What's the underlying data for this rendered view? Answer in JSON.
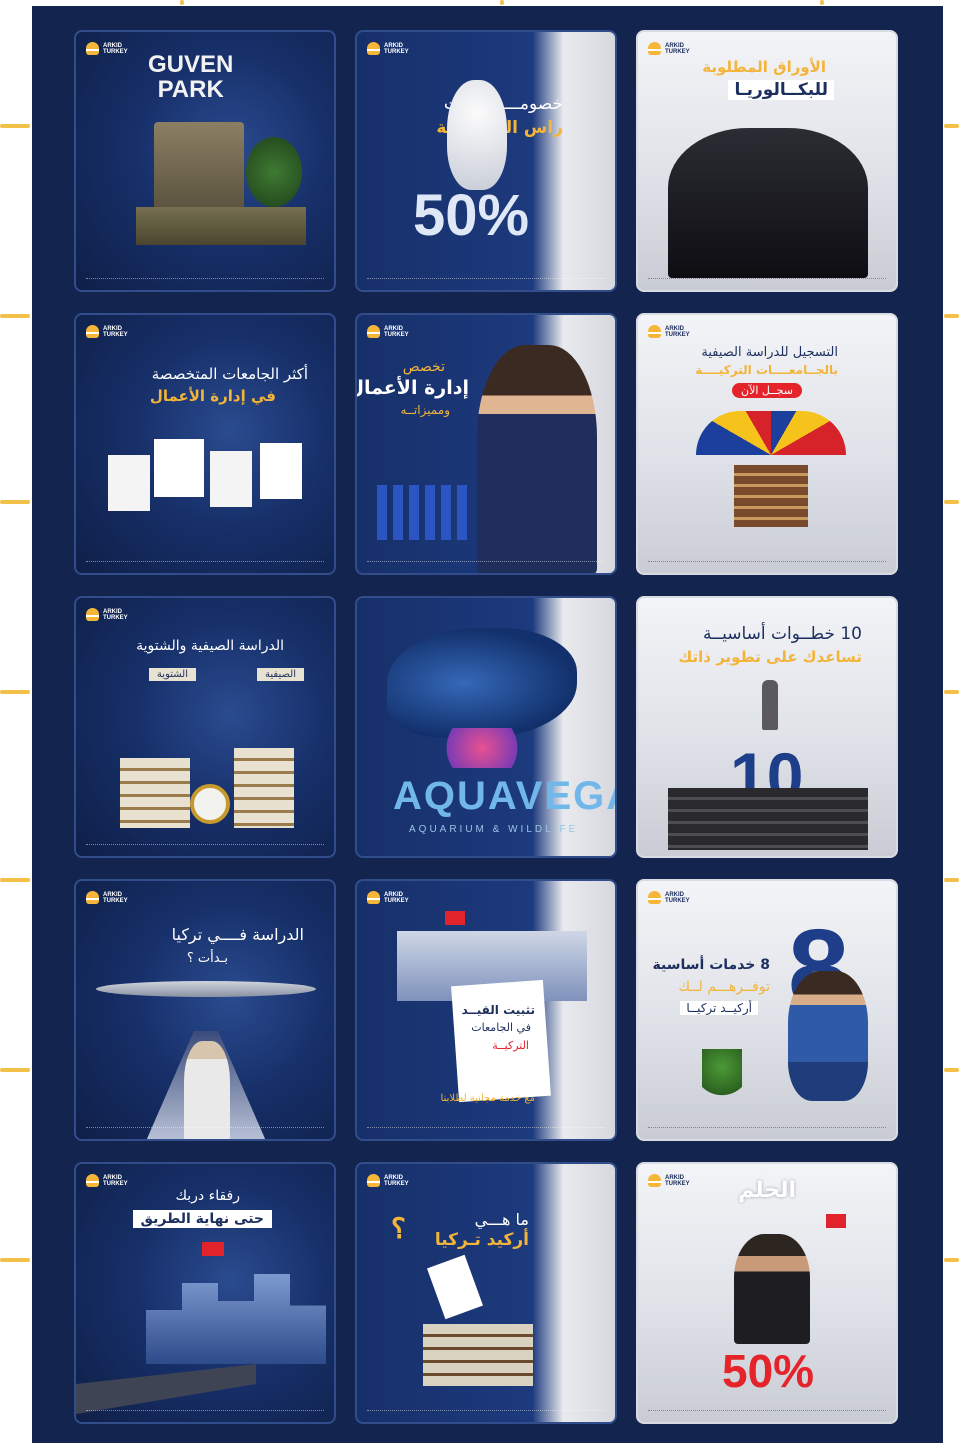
{
  "logo": {
    "text": "ARKID\nTURKEY",
    "name": "arkid-logo"
  },
  "tiles": {
    "t1": {
      "title": "GUVEN\nPARK"
    },
    "t2": {
      "line1": "خصومـــــــــــات",
      "line2": "راس الــــــسنة",
      "percent": "50%"
    },
    "t3": {
      "line1": "الأوراق المطلوبة",
      "line2": "للبكــالوريـا"
    },
    "t4": {
      "line1": "أكثر الجامعات المتخصصة",
      "line2": "في إدارة الأعمال"
    },
    "t5": {
      "line1": "تخصص",
      "line2": "إدارة الأعمال",
      "line3": "ومميزاتــه"
    },
    "t6": {
      "line1": "التسجيل للدراسة الصيفية",
      "line2": "بالجــامعــــات التركيــــة",
      "button": "سجــل الآن"
    },
    "t7": {
      "title": "الدراسة الصيفية والشتوية",
      "col1": "الشتوية",
      "col2": "الصيفية"
    },
    "t8": {
      "title": "AQUAVEGA",
      "subtitle": "AQUARIUM & WILDLIFE"
    },
    "t9": {
      "line1": "10 خطــوات أساسيــة",
      "line2": "تساعدك على تطوير ذاتك",
      "number": "10"
    },
    "t10": {
      "line1": "الدراسة فــــي تركيا",
      "line2": "بـدأت ؟"
    },
    "t11": {
      "line1": "تثبيت القيــد",
      "line2": "في الجامعات",
      "line3": "التركيــة",
      "note": "مع خدمة مجانية لطلابنا"
    },
    "t12": {
      "line1": "8 خدمات أساسية",
      "line2": "توفــرهـــم لــك",
      "line3": "أركيــد تركيــا",
      "number": "8"
    },
    "t13": {
      "line1": "رفقاء دربك",
      "line2": "حتى نهاية الطريق"
    },
    "t14": {
      "line1": "ما هـــي",
      "line2": "أركيد تـركيا",
      "mark": "؟"
    },
    "t15": {
      "title": "الحلم",
      "percent": "50%"
    }
  },
  "colors": {
    "board": "#13244f",
    "accent": "#f3b43a",
    "red": "#e5232a",
    "deco": "#f3c04a"
  }
}
